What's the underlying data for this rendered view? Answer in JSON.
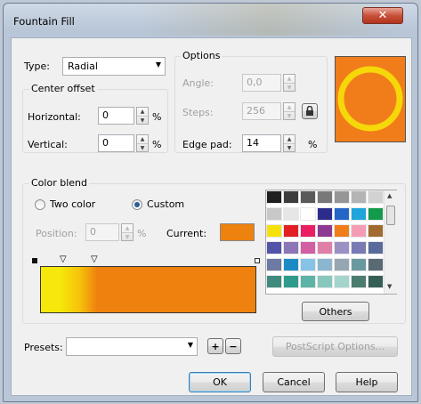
{
  "dialog": {
    "title": "Fountain Fill"
  },
  "type": {
    "label": "Type:",
    "value": "Radial"
  },
  "center_offset": {
    "legend": "Center offset",
    "horizontal_label": "Horizontal:",
    "horizontal_value": "0",
    "vertical_label": "Vertical:",
    "vertical_value": "0",
    "unit": "%"
  },
  "options": {
    "legend": "Options",
    "angle_label": "Angle:",
    "angle_value": "0,0",
    "steps_label": "Steps:",
    "steps_value": "256",
    "edge_pad_label": "Edge pad:",
    "edge_pad_value": "14",
    "unit": "%"
  },
  "color_blend": {
    "legend": "Color blend",
    "two_color_label": "Two color",
    "custom_label": "Custom",
    "selected_mode": "custom",
    "position_label": "Position:",
    "position_value": "0",
    "unit": "%",
    "current_label": "Current:",
    "current_color": "#ee820f",
    "gradient_stops": [
      "#f6e80a",
      "#f7c30b",
      "#ef820f"
    ],
    "palette": [
      [
        "#1f1f1f",
        "#3c3c3c",
        "#5a5a5a",
        "#787878",
        "#969696",
        "#b4b4b4",
        "#d2d2d2"
      ],
      [
        "#c8c8c8",
        "#e6e6e6",
        "#ffffff",
        "#2c2c8c",
        "#2466c7",
        "#1fa4dc",
        "#139a4a"
      ],
      [
        "#f6e10a",
        "#e31e24",
        "#ea1e63",
        "#8e3a93",
        "#f07d1a",
        "#f59cb4",
        "#a26a2f"
      ],
      [
        "#5353a9",
        "#8c76b7",
        "#d25ea3",
        "#e07fa8",
        "#9c8fc4",
        "#7a7ab4",
        "#5a6a9a"
      ],
      [
        "#6d7aa3",
        "#1c8bc5",
        "#87c3e6",
        "#8cb6d0",
        "#96a7b3",
        "#6a9aa0",
        "#5a6a73"
      ],
      [
        "#3f8a7c",
        "#2e9b8c",
        "#5cb3a6",
        "#88c7be",
        "#a3d5cd",
        "#4a7d6f",
        "#355f56"
      ]
    ],
    "others_label": "Others"
  },
  "presets": {
    "label": "Presets:",
    "value": "",
    "add_label": "+",
    "remove_label": "−"
  },
  "buttons": {
    "postscript_label": "PostScript Options...",
    "ok_label": "OK",
    "cancel_label": "Cancel",
    "help_label": "Help"
  },
  "preview": {
    "background_color": "#f07d1a",
    "ring_color": "#f6d80a"
  }
}
